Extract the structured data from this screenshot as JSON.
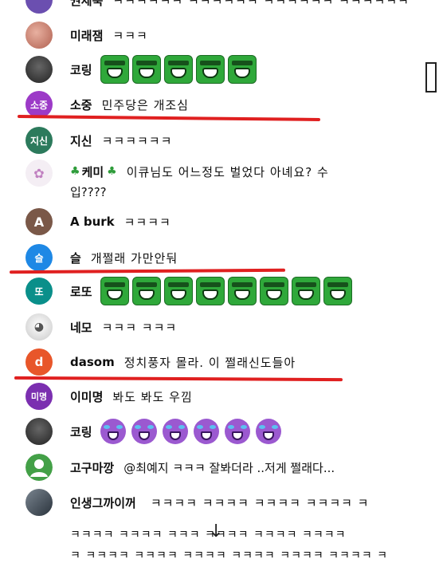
{
  "chat": {
    "messages": [
      {
        "author": "권세욱",
        "text": "ㅋㅋㅋㅋㅋㅋ ㅋㅋㅋㅋㅋㅋ ㅋㅋㅋㅋㅋㅋ ㅋㅋㅋㅋㅋㅋ",
        "avatar": "",
        "color": "#6b4fb0"
      },
      {
        "author": "미래잼",
        "text": "ㅋㅋㅋ",
        "avatar": "",
        "color": "#c98878"
      },
      {
        "author": "코링",
        "text": "",
        "emoji": "hulk-laugh-emoji",
        "emoji_count": 5,
        "avatar": "",
        "color": "#3a3a3a"
      },
      {
        "author": "소중",
        "text": "민주당은 개조심",
        "avatar": "소중",
        "color": "#9c3ac7"
      },
      {
        "author": "지신",
        "text": "ㅋㅋㅋㅋㅋㅋ",
        "avatar": "지신",
        "color": "#2c7a5c"
      },
      {
        "author": "케미",
        "text": "이큐님도 어느정도 벌었다 아녜요? 수",
        "text_cont": "입????",
        "avatar": "",
        "color": "#f0e6f0"
      },
      {
        "author": "A burk",
        "text": "ㅋㅋㅋㅋ",
        "avatar": "A",
        "color": "#7a5848"
      },
      {
        "author": "슬",
        "text": "개쩔래 가만안둬",
        "avatar": "슬",
        "color": "#1e88e5"
      },
      {
        "author": "로또",
        "text": "",
        "emoji": "hulk-laugh-emoji",
        "emoji_count": 8,
        "avatar": "또",
        "color": "#0a8f8a"
      },
      {
        "author": "네모",
        "text": "ㅋㅋㅋ ㅋㅋㅋ",
        "avatar": "",
        "color": "#d8d8d8"
      },
      {
        "author": "dasom",
        "text": "정치풍자 몰라. 이 쩔래신도들아",
        "avatar": "d",
        "color": "#e8562a"
      },
      {
        "author": "이미명",
        "text": "봐도 봐도 우낌",
        "avatar": "미명",
        "color": "#7b2fb0"
      },
      {
        "author": "코링",
        "text": "",
        "emoji": "purple-laugh-emoji",
        "emoji_count": 6,
        "avatar": "",
        "color": "#3a3a3a"
      },
      {
        "author": "고구마깡",
        "text": "@최예지 ㅋㅋㅋ 잘봐더라 ..저게 쩔래다...",
        "avatar": "",
        "color": "#43a047"
      },
      {
        "author": "인생그까이꺼",
        "text": "ㅋㅋㅋㅋ ㅋㅋㅋㅋ ㅋㅋㅋㅋ ㅋㅋㅋㅋ ㅋ",
        "avatar": "",
        "color": "#4a5560"
      }
    ],
    "long_lines": [
      "ㅋㅋㅋㅋ ㅋㅋㅋㅋ ㅋㅋㅋ         ㅋㅋㅋㅋ ㅋㅋㅋㅋ ㅋㅋㅋㅋ",
      "ㅋ ㅋㅋㅋㅋ ㅋㅋㅋㅋ ㅋㅋㅋㅋ ㅋㅋㅋㅋ ㅋㅋㅋㅋ ㅋㅋㅋㅋ ㅋ"
    ],
    "accent_underline": "#e02020"
  }
}
